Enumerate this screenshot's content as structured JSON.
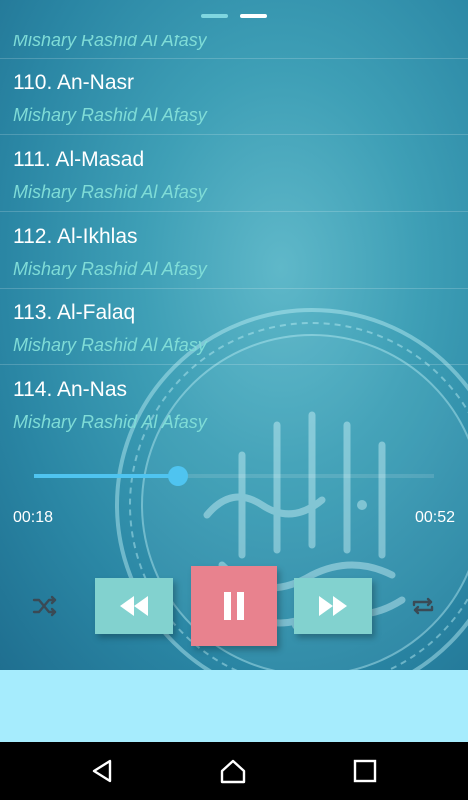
{
  "playlist": {
    "partial_reciter": "Mishary Rashid Al Afasy",
    "items": [
      {
        "title": "110. An-Nasr",
        "reciter": "Mishary Rashid Al Afasy"
      },
      {
        "title": "111. Al-Masad",
        "reciter": "Mishary Rashid Al Afasy"
      },
      {
        "title": "112. Al-Ikhlas",
        "reciter": "Mishary Rashid Al Afasy"
      },
      {
        "title": "113. Al-Falaq",
        "reciter": "Mishary Rashid Al Afasy"
      },
      {
        "title": "114. An-Nas",
        "reciter": "Mishary Rashid Al Afasy"
      }
    ]
  },
  "player": {
    "current_time": "00:18",
    "total_time": "00:52",
    "progress": 0.36
  },
  "controls": {
    "shuffle_icon": "shuffle-icon",
    "previous_icon": "rewind-icon",
    "play_state_icon": "pause-icon",
    "next_icon": "fast-forward-icon",
    "repeat_icon": "repeat-icon"
  },
  "pager": {
    "pages": 2,
    "active_page": 2
  },
  "colors": {
    "accent": "#4fc4f0",
    "pause_button": "#e8828e",
    "skip_buttons": "#82d2cf",
    "reciter_text": "#7fdcd7",
    "banner": "#a6ecfd"
  },
  "system_nav": {
    "back": "back-icon",
    "home": "home-icon",
    "recent": "recent-apps-icon"
  }
}
